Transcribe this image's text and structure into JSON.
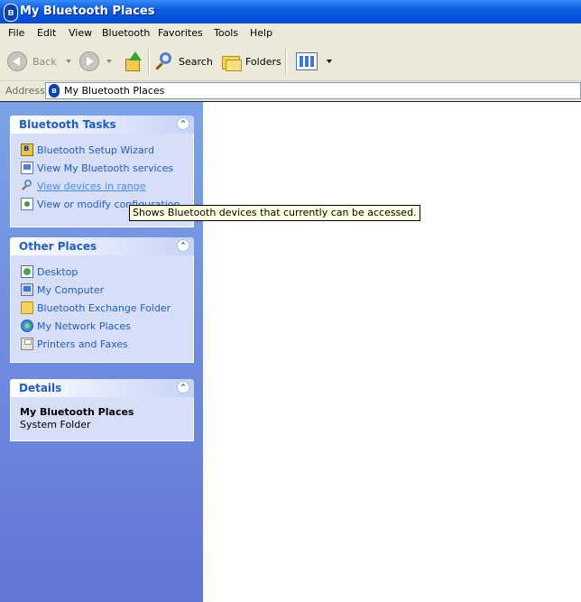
{
  "window": {
    "title": "My Bluetooth Places"
  },
  "menu": [
    "File",
    "Edit",
    "View",
    "Bluetooth",
    "Favorites",
    "Tools",
    "Help"
  ],
  "toolbar": {
    "back_label": "Back",
    "search_label": "Search",
    "folders_label": "Folders"
  },
  "address": {
    "label": "Address",
    "value": "My Bluetooth Places"
  },
  "panels": {
    "bluetooth_tasks": {
      "title": "Bluetooth Tasks",
      "items": [
        {
          "label": "Bluetooth Setup Wizard",
          "icon": "bluetooth-wizard-icon"
        },
        {
          "label": "View My Bluetooth services",
          "icon": "services-icon"
        },
        {
          "label": "View devices in range",
          "icon": "magnifier-icon"
        },
        {
          "label": "View or modify configuration",
          "icon": "configuration-icon"
        }
      ]
    },
    "other_places": {
      "title": "Other Places",
      "items": [
        {
          "label": "Desktop",
          "icon": "desktop-icon"
        },
        {
          "label": "My Computer",
          "icon": "computer-icon"
        },
        {
          "label": "Bluetooth Exchange Folder",
          "icon": "folder-icon"
        },
        {
          "label": "My Network Places",
          "icon": "network-icon"
        },
        {
          "label": "Printers and Faxes",
          "icon": "printer-icon"
        }
      ]
    },
    "details": {
      "title": "Details",
      "name": "My Bluetooth Places",
      "type": "System Folder"
    }
  },
  "tooltip": {
    "text": "Shows Bluetooth devices that currently can be accessed."
  }
}
